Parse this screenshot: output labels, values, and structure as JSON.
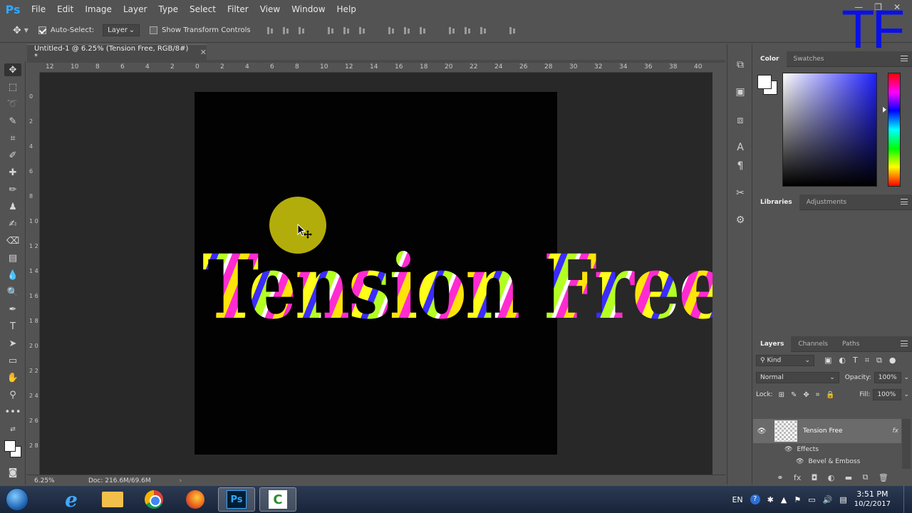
{
  "app": {
    "logo": "Ps"
  },
  "menu": [
    "File",
    "Edit",
    "Image",
    "Layer",
    "Type",
    "Select",
    "Filter",
    "View",
    "Window",
    "Help"
  ],
  "window_controls": {
    "minimize": "—",
    "restore": "❐",
    "close": "✕"
  },
  "options": {
    "auto_select_label": "Auto-Select:",
    "auto_select_checked": true,
    "auto_select_target": "Layer",
    "transform_controls_label": "Show Transform Controls",
    "transform_controls_checked": false
  },
  "watermark": "TF",
  "document": {
    "tab_title": "Untitled-1 @ 6.25% (Tension Free, RGB/8#) *",
    "close": "✕",
    "text": "Tension Free"
  },
  "ruler": {
    "top": [
      "12",
      "10",
      "8",
      "6",
      "4",
      "2",
      "0",
      "2",
      "4",
      "6",
      "8",
      "10",
      "12",
      "14",
      "16",
      "18",
      "20",
      "22",
      "24",
      "26",
      "28",
      "30",
      "32",
      "34",
      "36",
      "38",
      "40"
    ],
    "left": [
      "0",
      "2",
      "4",
      "6",
      "8",
      "1 0",
      "1 2",
      "1 4",
      "1 6",
      "1 8",
      "2 0",
      "2 2",
      "2 4",
      "2 6",
      "2 8"
    ]
  },
  "status": {
    "zoom": "6.25%",
    "doc": "Doc: 216.6M/69.6M",
    "arrow": "›"
  },
  "panels": {
    "color": {
      "tabs": [
        "Color",
        "Swatches"
      ],
      "foreground": "#ffffff",
      "background": "#ffffff"
    },
    "libraries": {
      "tabs": [
        "Libraries",
        "Adjustments"
      ]
    },
    "layers": {
      "tabs": [
        "Layers",
        "Channels",
        "Paths"
      ],
      "filter_kind": "Kind",
      "blend_mode": "Normal",
      "opacity_label": "Opacity:",
      "opacity": "100%",
      "lock_label": "Lock:",
      "fill_label": "Fill:",
      "fill": "100%",
      "layer_name": "Tension Free",
      "fx": "fx",
      "effects_label": "Effects",
      "effect_1": "Bevel & Emboss"
    }
  },
  "taskbar": {
    "language": "EN",
    "time": "3:51 PM",
    "date": "10/2/2017"
  }
}
